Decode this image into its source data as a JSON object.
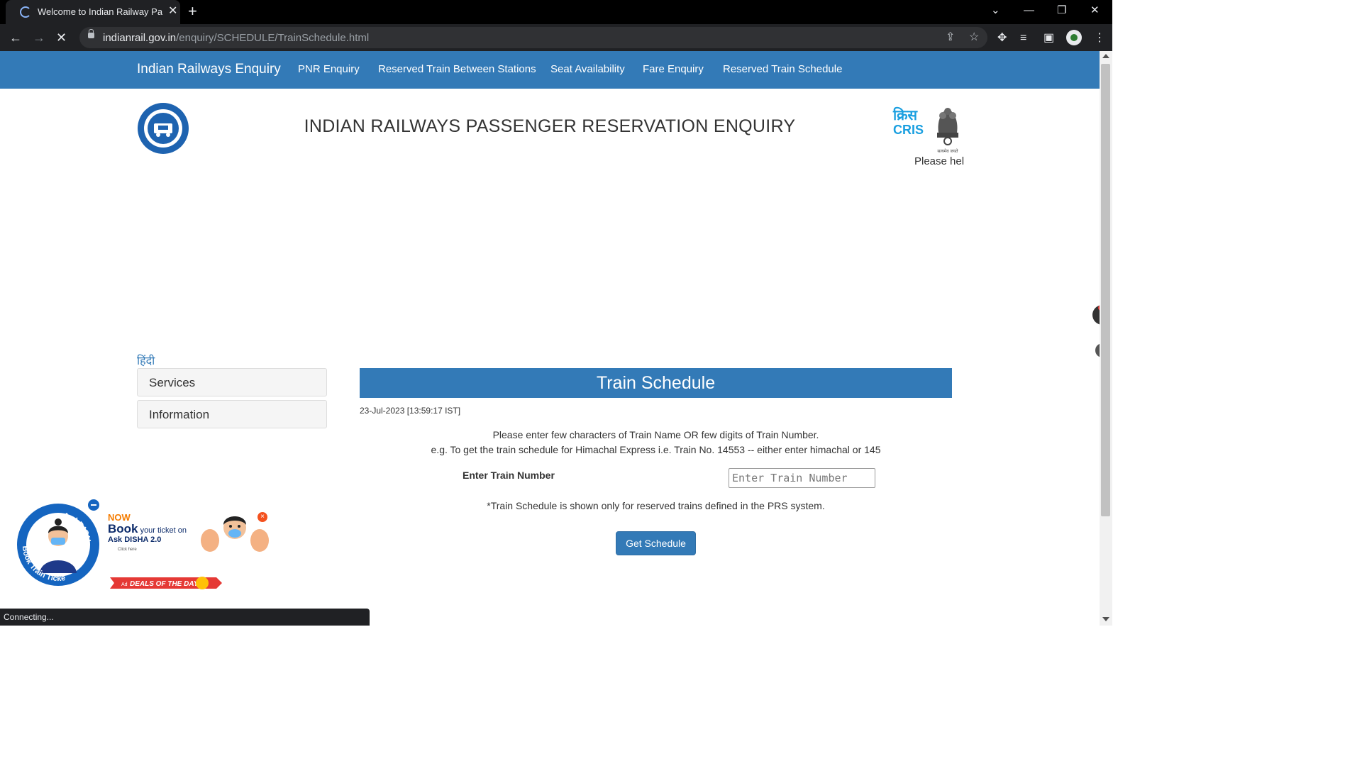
{
  "browser": {
    "tab_title": "Welcome to Indian Railway Passe",
    "url_domain": "indianrail.gov.in",
    "url_path": "/enquiry/SCHEDULE/TrainSchedule.html",
    "status_text": "Connecting..."
  },
  "navbar": {
    "brand": "Indian Railways Enquiry",
    "links": [
      "PNR Enquiry",
      "Reserved Train Between Stations",
      "Seat Availability",
      "Fare Enquiry",
      "Reserved Train Schedule"
    ]
  },
  "header": {
    "title": "INDIAN RAILWAYS PASSENGER RESERVATION ENQUIRY",
    "cris_hindi": "क्रिस",
    "cris_label": "CRIS",
    "emblem_motto": "सत्यमेव जयते",
    "help_text": "Please hel"
  },
  "sidebar": {
    "language_link": "हिंदी",
    "panels": [
      "Services",
      "Information"
    ]
  },
  "schedule": {
    "heading": "Train Schedule",
    "timestamp": "23-Jul-2023 [13:59:17 IST]",
    "instruction_1": "Please enter few characters of Train Name OR few digits of Train Number.",
    "instruction_2": "e.g. To get the train schedule for Himachal Express i.e. Train No. 14553 -- either enter himachal or 145",
    "field_label": "Enter Train Number",
    "input_placeholder": "Enter Train Number",
    "input_value": "",
    "note": "*Train Schedule is shown only for reserved trains defined in the PRS system.",
    "button_label": "Get Schedule"
  },
  "promo": {
    "badge_text": "AskDISHA 2.0",
    "badge_subtext": "Book Train Ticket",
    "now": "NOW",
    "book": "Book",
    "book_rest": "your ticket on",
    "disha_line": "Ask DISHA 2.0",
    "click_here": "Click here",
    "deals": "DEALS OF THE DAY",
    "ad_label": "Ad"
  },
  "colors": {
    "primary": "#337ab7",
    "chrome_dark": "#202124",
    "cris_blue": "#1a9fe0"
  },
  "icons": [
    "loading-spinner-icon",
    "close-icon",
    "plus-icon",
    "back-icon",
    "forward-icon",
    "stop-icon",
    "lock-icon",
    "share-icon",
    "star-icon",
    "puzzle-icon",
    "media-icon",
    "sidepanel-icon",
    "menu-dots-icon"
  ]
}
